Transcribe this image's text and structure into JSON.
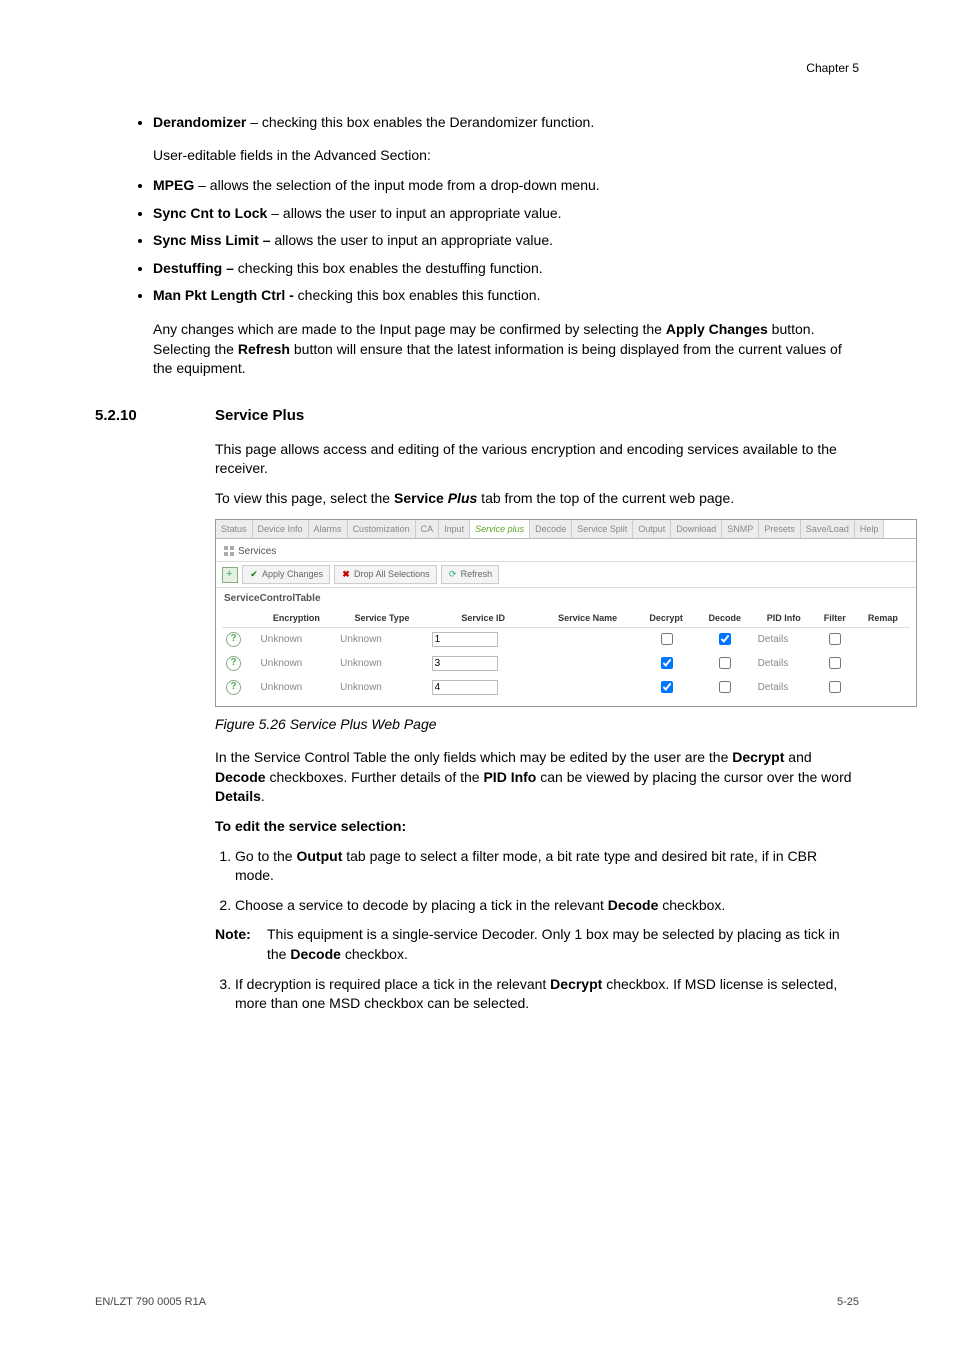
{
  "chapter": "Chapter 5",
  "intro_bullets": [
    {
      "term": "Derandomizer",
      "desc": " – checking this box enables the Derandomizer function."
    }
  ],
  "user_editable_intro": "User-editable fields in the Advanced Section:",
  "adv_bullets": [
    {
      "term": "MPEG",
      "desc": " – allows the selection of the input mode from a drop-down menu."
    },
    {
      "term": "Sync Cnt to Lock",
      "desc": " – allows the user to input an appropriate value."
    },
    {
      "term": "Sync Miss Limit –",
      "desc": " allows the user to input an appropriate value."
    },
    {
      "term": "Destuffing –",
      "desc": " checking this box enables the destuffing function."
    },
    {
      "term": "Man Pkt Length Ctrl -",
      "desc": " checking this box enables this function."
    }
  ],
  "apply_para": {
    "pre": "Any changes which are made to the Input page may be confirmed by selecting the ",
    "b1": "Apply Changes",
    "mid": " button. Selecting the ",
    "b2": "Refresh",
    "post": " button will ensure that the latest information is being displayed from the current values of the equipment."
  },
  "section": {
    "num": "5.2.10",
    "title": "Service Plus"
  },
  "sp_para": "This page allows access and editing of the various encryption and encoding services available to the receiver.",
  "sp_view": {
    "pre": "To view this page, select the ",
    "b": "Service",
    "i": " Plus",
    "post": " tab from the top of the current web page."
  },
  "mock": {
    "tabs": [
      "Status",
      "Device Info",
      "Alarms",
      "Customization",
      "CA",
      "Input",
      "Service plus",
      "Decode",
      "Service Split",
      "Output",
      "Download",
      "SNMP",
      "Presets",
      "Save/Load",
      "Help"
    ],
    "active_tab_index": 6,
    "panel_title": "Services",
    "buttons": {
      "apply": "Apply Changes",
      "drop": "Drop All Selections",
      "refresh": "Refresh"
    },
    "table_title": "ServiceControlTable",
    "headers": [
      "",
      "Encryption",
      "Service Type",
      "Service ID",
      "Service Name",
      "Decrypt",
      "Decode",
      "PID Info",
      "Filter",
      "Remap"
    ],
    "rows": [
      {
        "enc": "Unknown",
        "stype": "Unknown",
        "sid": "1",
        "sname": "",
        "decrypt": false,
        "decode": true,
        "pid": "Details",
        "filter": false,
        "remap": ""
      },
      {
        "enc": "Unknown",
        "stype": "Unknown",
        "sid": "3",
        "sname": "",
        "decrypt": true,
        "decode": false,
        "pid": "Details",
        "filter": false,
        "remap": ""
      },
      {
        "enc": "Unknown",
        "stype": "Unknown",
        "sid": "4",
        "sname": "",
        "decrypt": true,
        "decode": false,
        "pid": "Details",
        "filter": false,
        "remap": ""
      }
    ]
  },
  "figure_caption": "Figure 5.26 Service Plus Web Page",
  "sct_para": {
    "pre": "In the Service Control Table the only fields which may be edited by the user are the ",
    "b1": "Decrypt",
    "mid1": " and ",
    "b2": "Decode",
    "mid2": " checkboxes. Further details of the ",
    "b3": "PID Info",
    "mid3": " can be viewed by placing the cursor over the word ",
    "b4": "Details",
    "post": "."
  },
  "edit_heading": "To edit the service selection:",
  "step1": {
    "pre": "Go to the ",
    "b": "Output",
    "post": " tab page to select a filter mode, a bit rate type and desired bit rate, if in CBR mode."
  },
  "step2": {
    "pre": "Choose a service to decode by placing a tick in the relevant ",
    "b": "Decode",
    "post": " checkbox."
  },
  "note": {
    "label": "Note:",
    "pre": "This equipment is a single-service Decoder. Only 1 box may be selected by placing as tick in the ",
    "b": "Decode",
    "post": " checkbox."
  },
  "step3": {
    "pre": "If decryption is required place a tick in the relevant ",
    "b": "Decrypt",
    "post": " checkbox. If MSD license is selected, more than one MSD checkbox can be selected."
  },
  "footer": {
    "left": "EN/LZT 790 0005 R1A",
    "right": "5-25"
  }
}
